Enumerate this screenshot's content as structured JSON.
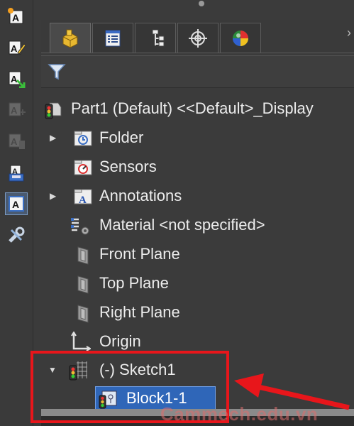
{
  "left_toolbar": {
    "items": [
      {
        "icon": "smart-dimension-note-icon",
        "state": "normal"
      },
      {
        "icon": "edit-note-icon",
        "state": "normal"
      },
      {
        "icon": "note-arrow-icon",
        "state": "normal"
      },
      {
        "icon": "note-add-icon",
        "state": "disabled"
      },
      {
        "icon": "note-grayed-icon",
        "state": "disabled"
      },
      {
        "icon": "save-note-icon",
        "state": "normal"
      },
      {
        "icon": "note-frame-icon",
        "state": "selected"
      },
      {
        "icon": "tools-icon",
        "state": "normal"
      }
    ]
  },
  "tabs": [
    {
      "icon": "feature-manager-icon",
      "active": true
    },
    {
      "icon": "property-manager-icon",
      "active": false
    },
    {
      "icon": "configuration-manager-icon",
      "active": false
    },
    {
      "icon": "dimxpert-manager-icon",
      "active": false
    },
    {
      "icon": "display-manager-icon",
      "active": false
    }
  ],
  "filter": {
    "icon": "filter-funnel-icon"
  },
  "tree": {
    "root": {
      "label": "Part1 (Default) <<Default>_Display",
      "icon": "part-status-icon"
    },
    "items": [
      {
        "label": "Folder",
        "icon": "folder-icon",
        "expandable": true
      },
      {
        "label": "Sensors",
        "icon": "sensors-icon",
        "expandable": false
      },
      {
        "label": "Annotations",
        "icon": "annotations-icon",
        "expandable": true
      },
      {
        "label": "Material <not specified>",
        "icon": "material-icon",
        "expandable": false
      },
      {
        "label": "Front Plane",
        "icon": "plane-icon",
        "expandable": false
      },
      {
        "label": "Top Plane",
        "icon": "plane-icon",
        "expandable": false
      },
      {
        "label": "Right Plane",
        "icon": "plane-icon",
        "expandable": false
      },
      {
        "label": "Origin",
        "icon": "origin-icon",
        "expandable": false
      },
      {
        "label": "(-) Sketch1",
        "icon": "sketch-icon",
        "expanded": true
      },
      {
        "label": "Block1-1",
        "icon": "block-icon",
        "selected": true
      }
    ]
  },
  "watermark": "Cammech.edu.vn",
  "colors": {
    "background": "#3b3b3b",
    "selection": "#2f66b8",
    "annotation_red": "#e8161b",
    "text": "#ececec"
  }
}
